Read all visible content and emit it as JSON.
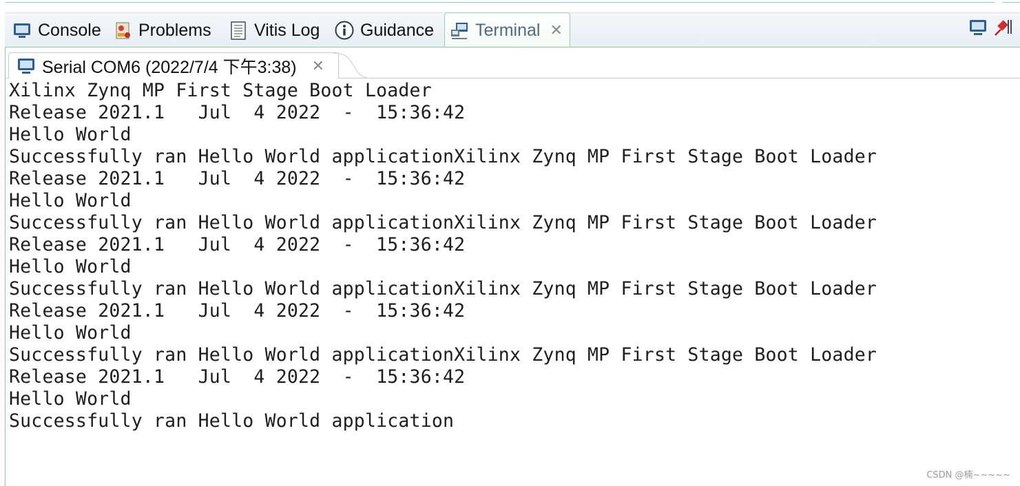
{
  "view_tabs": [
    {
      "label": "Console",
      "icon": "console-icon",
      "active": false
    },
    {
      "label": "Problems",
      "icon": "problems-icon",
      "active": false
    },
    {
      "label": "Vitis Log",
      "icon": "log-icon",
      "active": false
    },
    {
      "label": "Guidance",
      "icon": "info-icon",
      "active": false
    },
    {
      "label": "Terminal",
      "icon": "terminal-icon",
      "active": true
    }
  ],
  "view_toolbar": [
    {
      "icon": "display-icon"
    },
    {
      "icon": "pin-icon"
    }
  ],
  "terminal_tab": {
    "label": "Serial COM6 (2022/7/4 下午3:38)",
    "icon": "serial-monitor-icon"
  },
  "terminal_output": [
    "Xilinx Zynq MP First Stage Boot Loader",
    "Release 2021.1   Jul  4 2022  -  15:36:42",
    "Hello World",
    "Successfully ran Hello World applicationXilinx Zynq MP First Stage Boot Loader",
    "Release 2021.1   Jul  4 2022  -  15:36:42",
    "Hello World",
    "Successfully ran Hello World applicationXilinx Zynq MP First Stage Boot Loader",
    "Release 2021.1   Jul  4 2022  -  15:36:42",
    "Hello World",
    "Successfully ran Hello World applicationXilinx Zynq MP First Stage Boot Loader",
    "Release 2021.1   Jul  4 2022  -  15:36:42",
    "Hello World",
    "Successfully ran Hello World applicationXilinx Zynq MP First Stage Boot Loader",
    "Release 2021.1   Jul  4 2022  -  15:36:42",
    "Hello World",
    "Successfully ran Hello World application"
  ],
  "watermark": "CSDN @楠~~~~~",
  "colors": {
    "active_tab_border": "#9bcfab",
    "tabbar_bg": "#e9eef3",
    "terminal_text": "#1e1e1e"
  }
}
